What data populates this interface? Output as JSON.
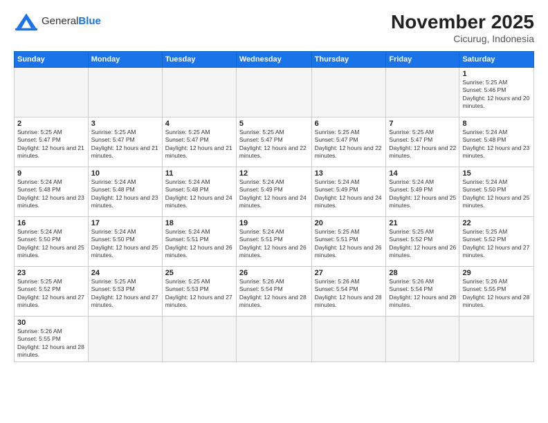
{
  "logo": {
    "text_general": "General",
    "text_blue": "Blue"
  },
  "header": {
    "month_year": "November 2025",
    "location": "Cicurug, Indonesia"
  },
  "weekdays": [
    "Sunday",
    "Monday",
    "Tuesday",
    "Wednesday",
    "Thursday",
    "Friday",
    "Saturday"
  ],
  "weeks": [
    [
      {
        "day": "",
        "empty": true
      },
      {
        "day": "",
        "empty": true
      },
      {
        "day": "",
        "empty": true
      },
      {
        "day": "",
        "empty": true
      },
      {
        "day": "",
        "empty": true
      },
      {
        "day": "",
        "empty": true
      },
      {
        "day": "1",
        "sunrise": "5:25 AM",
        "sunset": "5:46 PM",
        "daylight": "12 hours and 20 minutes."
      }
    ],
    [
      {
        "day": "2",
        "sunrise": "5:25 AM",
        "sunset": "5:47 PM",
        "daylight": "12 hours and 21 minutes."
      },
      {
        "day": "3",
        "sunrise": "5:25 AM",
        "sunset": "5:47 PM",
        "daylight": "12 hours and 21 minutes."
      },
      {
        "day": "4",
        "sunrise": "5:25 AM",
        "sunset": "5:47 PM",
        "daylight": "12 hours and 21 minutes."
      },
      {
        "day": "5",
        "sunrise": "5:25 AM",
        "sunset": "5:47 PM",
        "daylight": "12 hours and 22 minutes."
      },
      {
        "day": "6",
        "sunrise": "5:25 AM",
        "sunset": "5:47 PM",
        "daylight": "12 hours and 22 minutes."
      },
      {
        "day": "7",
        "sunrise": "5:25 AM",
        "sunset": "5:47 PM",
        "daylight": "12 hours and 22 minutes."
      },
      {
        "day": "8",
        "sunrise": "5:24 AM",
        "sunset": "5:48 PM",
        "daylight": "12 hours and 23 minutes."
      }
    ],
    [
      {
        "day": "9",
        "sunrise": "5:24 AM",
        "sunset": "5:48 PM",
        "daylight": "12 hours and 23 minutes."
      },
      {
        "day": "10",
        "sunrise": "5:24 AM",
        "sunset": "5:48 PM",
        "daylight": "12 hours and 23 minutes."
      },
      {
        "day": "11",
        "sunrise": "5:24 AM",
        "sunset": "5:48 PM",
        "daylight": "12 hours and 24 minutes."
      },
      {
        "day": "12",
        "sunrise": "5:24 AM",
        "sunset": "5:49 PM",
        "daylight": "12 hours and 24 minutes."
      },
      {
        "day": "13",
        "sunrise": "5:24 AM",
        "sunset": "5:49 PM",
        "daylight": "12 hours and 24 minutes."
      },
      {
        "day": "14",
        "sunrise": "5:24 AM",
        "sunset": "5:49 PM",
        "daylight": "12 hours and 25 minutes."
      },
      {
        "day": "15",
        "sunrise": "5:24 AM",
        "sunset": "5:50 PM",
        "daylight": "12 hours and 25 minutes."
      }
    ],
    [
      {
        "day": "16",
        "sunrise": "5:24 AM",
        "sunset": "5:50 PM",
        "daylight": "12 hours and 25 minutes."
      },
      {
        "day": "17",
        "sunrise": "5:24 AM",
        "sunset": "5:50 PM",
        "daylight": "12 hours and 25 minutes."
      },
      {
        "day": "18",
        "sunrise": "5:24 AM",
        "sunset": "5:51 PM",
        "daylight": "12 hours and 26 minutes."
      },
      {
        "day": "19",
        "sunrise": "5:24 AM",
        "sunset": "5:51 PM",
        "daylight": "12 hours and 26 minutes."
      },
      {
        "day": "20",
        "sunrise": "5:25 AM",
        "sunset": "5:51 PM",
        "daylight": "12 hours and 26 minutes."
      },
      {
        "day": "21",
        "sunrise": "5:25 AM",
        "sunset": "5:52 PM",
        "daylight": "12 hours and 26 minutes."
      },
      {
        "day": "22",
        "sunrise": "5:25 AM",
        "sunset": "5:52 PM",
        "daylight": "12 hours and 27 minutes."
      }
    ],
    [
      {
        "day": "23",
        "sunrise": "5:25 AM",
        "sunset": "5:52 PM",
        "daylight": "12 hours and 27 minutes."
      },
      {
        "day": "24",
        "sunrise": "5:25 AM",
        "sunset": "5:53 PM",
        "daylight": "12 hours and 27 minutes."
      },
      {
        "day": "25",
        "sunrise": "5:25 AM",
        "sunset": "5:53 PM",
        "daylight": "12 hours and 27 minutes."
      },
      {
        "day": "26",
        "sunrise": "5:26 AM",
        "sunset": "5:54 PM",
        "daylight": "12 hours and 28 minutes."
      },
      {
        "day": "27",
        "sunrise": "5:26 AM",
        "sunset": "5:54 PM",
        "daylight": "12 hours and 28 minutes."
      },
      {
        "day": "28",
        "sunrise": "5:26 AM",
        "sunset": "5:54 PM",
        "daylight": "12 hours and 28 minutes."
      },
      {
        "day": "29",
        "sunrise": "5:26 AM",
        "sunset": "5:55 PM",
        "daylight": "12 hours and 28 minutes."
      }
    ],
    [
      {
        "day": "30",
        "sunrise": "5:26 AM",
        "sunset": "5:55 PM",
        "daylight": "12 hours and 28 minutes."
      },
      {
        "day": "",
        "empty": true
      },
      {
        "day": "",
        "empty": true
      },
      {
        "day": "",
        "empty": true
      },
      {
        "day": "",
        "empty": true
      },
      {
        "day": "",
        "empty": true
      },
      {
        "day": "",
        "empty": true
      }
    ]
  ],
  "labels": {
    "sunrise": "Sunrise:",
    "sunset": "Sunset:",
    "daylight": "Daylight:"
  }
}
